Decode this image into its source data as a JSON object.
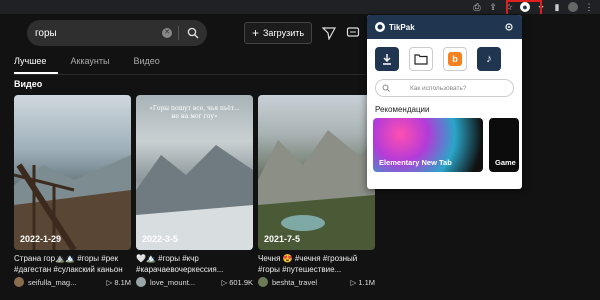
{
  "search": {
    "value": "горы"
  },
  "header": {
    "upload_label": "Загрузить"
  },
  "tabs": [
    {
      "label": "Лучшее"
    },
    {
      "label": "Аккаунты"
    },
    {
      "label": "Видео"
    }
  ],
  "section": {
    "title": "Видео"
  },
  "videos": [
    {
      "date": "2022-1-29",
      "caption": "",
      "desc_line1": "Страна гор⛰️🏔️ #горы #рек",
      "desc_line2": "#дагестан #сулакский каньон",
      "user": "seifulla_mag...",
      "views": "8.1M"
    },
    {
      "date": "2022-3-5",
      "caption": "«Горы пошут все, чья пьёт... не на мог гоу»",
      "desc_line1": "🤍🏔️ #горы #кчр",
      "desc_line2": "#карачаевочеркессия...",
      "user": "love_mount...",
      "views": "601.9K"
    },
    {
      "date": "2021-7-5",
      "caption": "",
      "desc_line1": "Чечня 😍 #чечня #грозный",
      "desc_line2": "#горы #путешествие...",
      "user": "beshta_travel",
      "views": "1.1M"
    }
  ],
  "popup": {
    "title": "TikPak",
    "search_placeholder": "Как использовать?",
    "recommendations_title": "Рекомендации",
    "rec_items": [
      {
        "label": "Elementary New Tab"
      },
      {
        "label": "Game"
      }
    ]
  },
  "colors": {
    "popup_header": "#1f3550",
    "highlight": "#e02020",
    "background": "#121212"
  }
}
